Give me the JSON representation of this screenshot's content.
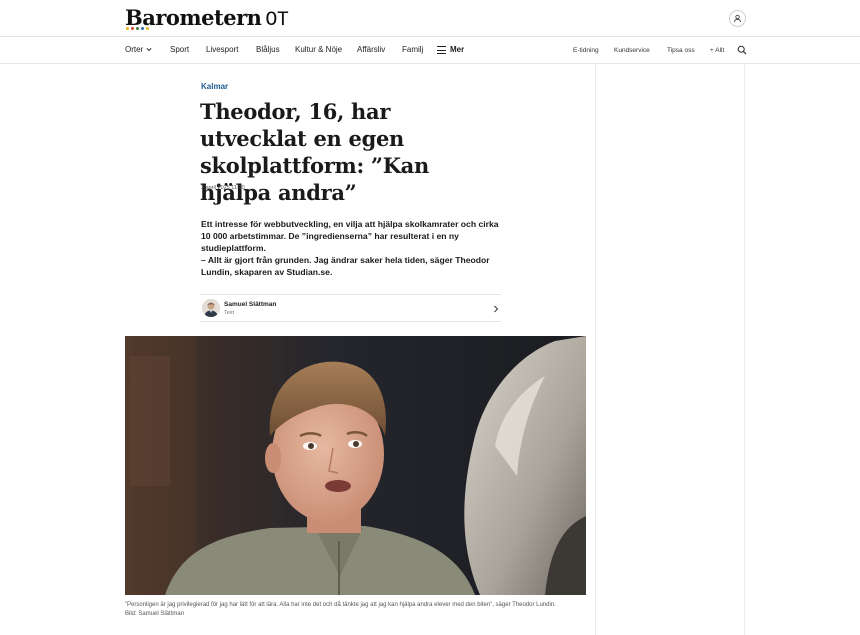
{
  "header": {
    "logo_text": "Barometern",
    "logo_suffix": "OT",
    "logo_dot_colors": [
      "#e8b81f",
      "#d9452f",
      "#3a7d44",
      "#2f6fb3",
      "#e8b81f"
    ]
  },
  "nav": {
    "items": [
      {
        "label": "Orter"
      },
      {
        "label": "Sport"
      },
      {
        "label": "Livesport"
      },
      {
        "label": "Blåljus"
      },
      {
        "label": "Kultur & Nöje"
      },
      {
        "label": "Affärsliv"
      },
      {
        "label": "Familj"
      },
      {
        "label": "Mer"
      }
    ],
    "right_items": [
      {
        "label": "E-tidning"
      },
      {
        "label": "Kundservice"
      },
      {
        "label": "Tipsa oss"
      },
      {
        "label": "+ Allt"
      }
    ]
  },
  "article": {
    "kicker": "Kalmar",
    "headline": "Theodor, 16, har utvecklat en egen skolplattform: ”Kan hjälpa andra”",
    "date": "2 april 2025 11:00",
    "lead_1": "Ett intresse för webbutveckling, en vilja att hjälpa skolkamrater och cirka 10 000 arbetstimmar. De ”ingredienserna” har resulterat i en ny studieplattform.",
    "lead_2": "– Allt är gjort från grunden. Jag ändrar saker hela tiden, säger Theodor Lundin, skaparen av Studian.se.",
    "author_name": "Samuel Slättman",
    "author_role": "Text",
    "caption": "”Personligen är jag privilegierad för jag har lätt för att lära. Alla har inte det och då tänkte jag att jag kan hjälpa andra elever med den biten”, säger Theodor Lundin.",
    "photo_credit": "Bild: Samuel Slättman"
  },
  "colors": {
    "kicker": "#1f5d91",
    "divider": "#e6e6e6"
  }
}
